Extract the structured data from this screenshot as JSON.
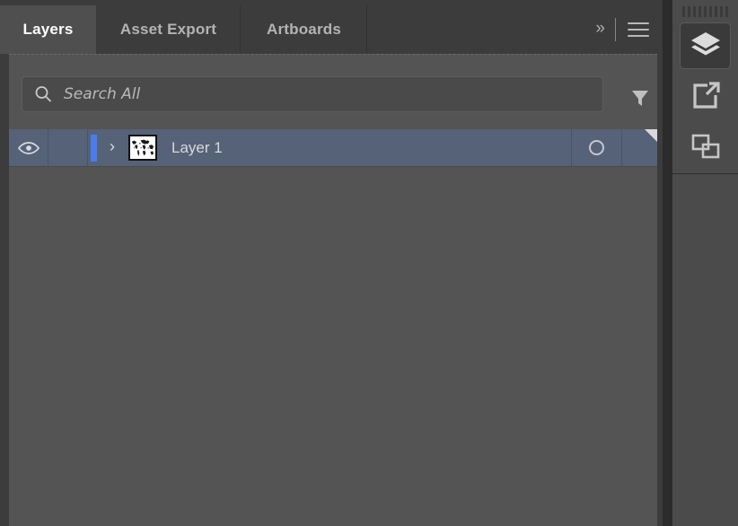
{
  "panel": {
    "tabs": [
      {
        "label": "Layers",
        "name": "tab-layers",
        "active": true
      },
      {
        "label": "Asset Export",
        "name": "tab-asset-export",
        "active": false
      },
      {
        "label": "Artboards",
        "name": "tab-artboards",
        "active": false
      }
    ],
    "controls": {
      "overflow_label": "››",
      "menu_icon": "hamburger-menu-icon"
    },
    "search": {
      "placeholder": "Search All",
      "value": "",
      "search_icon": "search-icon",
      "filter_icon": "filter-funnel-icon"
    },
    "layers": [
      {
        "name": "Layer 1",
        "visible": true,
        "locked": false,
        "selected": true,
        "expanded": false,
        "disclosure_glyph": "›",
        "thumbnail": "world-map-thumbnail",
        "target_indicator": "circle-outline",
        "appearance_flag": true
      }
    ]
  },
  "rail": {
    "grip": "drag-grip-handle",
    "buttons": [
      {
        "name": "rail-layers",
        "icon": "layers-stack-icon",
        "active": true
      },
      {
        "name": "rail-export",
        "icon": "export-arrow-icon",
        "active": false
      },
      {
        "name": "rail-artboards",
        "icon": "artboards-squares-icon",
        "active": false
      }
    ]
  },
  "colors": {
    "panel_background": "#545454",
    "tab_bar": "#3c3c3c",
    "tab_active": "#4f4f4f",
    "selected_row": "#566278",
    "selection_bar": "#4b7bef",
    "rail_background": "#4b4b4b",
    "text_primary": "#ffffff",
    "text_secondary": "#b4b4b4"
  }
}
